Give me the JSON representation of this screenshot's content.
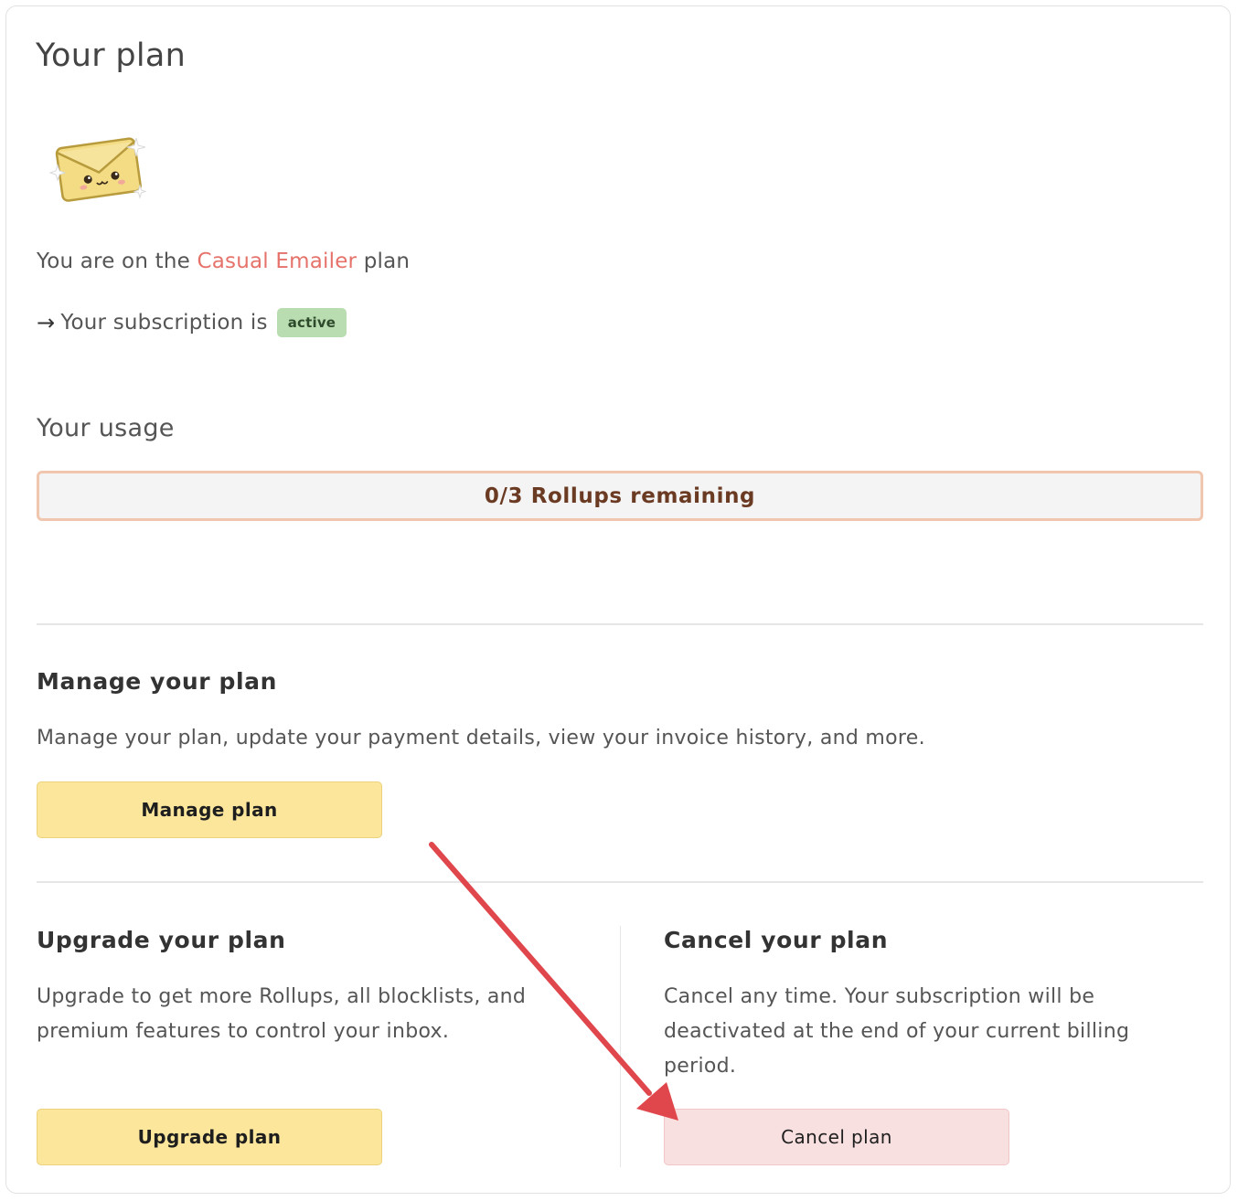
{
  "plan": {
    "title": "Your plan",
    "mascot_icon": "envelope-mascot-icon",
    "plan_prefix": "You are on the",
    "plan_name": "Casual Emailer",
    "plan_suffix": "plan",
    "plan_name_color": "#e6736b",
    "subscription_arrow": "→",
    "subscription_text": "Your subscription is",
    "status_badge": "active",
    "status_badge_color": "#b9ddb1"
  },
  "usage": {
    "title": "Your usage",
    "label": "0/3 Rollups remaining",
    "used": 0,
    "total": 3,
    "bar_border_color": "#f0c6ae"
  },
  "manage": {
    "title": "Manage your plan",
    "description": "Manage your plan, update your payment details, view your invoice history, and more.",
    "button_label": "Manage plan"
  },
  "upgrade": {
    "title": "Upgrade your plan",
    "description": "Upgrade to get more Rollups, all blocklists, and premium features to control your inbox.",
    "button_label": "Upgrade plan"
  },
  "cancel": {
    "title": "Cancel your plan",
    "description": "Cancel any time. Your subscription will be deactivated at the end of your current billing period.",
    "button_label": "Cancel plan"
  },
  "annotation": {
    "icon": "red-arrow-annotation",
    "color": "#e0474c"
  }
}
